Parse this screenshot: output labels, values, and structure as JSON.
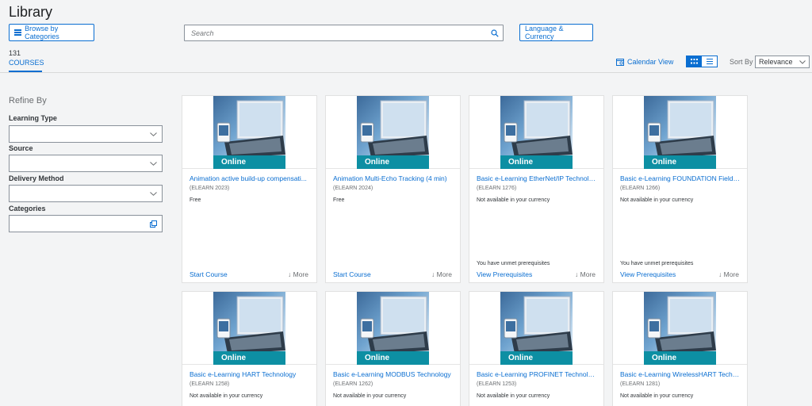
{
  "page": {
    "title": "Library"
  },
  "toolbar": {
    "browse_label": "Browse by Categories",
    "search_placeholder": "Search",
    "language_label": "Language & Currency"
  },
  "results": {
    "count": "131",
    "label": "COURSES"
  },
  "view": {
    "calendar_label": "Calendar View",
    "sort_label": "Sort By",
    "sort_value": "Relevance"
  },
  "refine": {
    "title": "Refine By",
    "filters": [
      {
        "label": "Learning Type"
      },
      {
        "label": "Source"
      },
      {
        "label": "Delivery Method"
      },
      {
        "label": "Categories"
      }
    ]
  },
  "colors": {
    "accent": "#0a6ed1",
    "badge": "#0d8fa3"
  },
  "courses": [
    {
      "badge": "Online",
      "title": "Animation active build-up compensati...",
      "code": "(ELEARN 2023)",
      "price": "Free",
      "note": "",
      "action": "Start Course",
      "more": "↓ More"
    },
    {
      "badge": "Online",
      "title": "Animation Multi-Echo Tracking (4 min)",
      "code": "(ELEARN 2024)",
      "price": "Free",
      "note": "",
      "action": "Start Course",
      "more": "↓ More"
    },
    {
      "badge": "Online",
      "title": "Basic e-Learning EtherNet/IP Technolo...",
      "code": "(ELEARN 1276)",
      "price": "Not available in your currency",
      "note": "You have unmet prerequisites",
      "action": "View Prerequisites",
      "more": "↓ More"
    },
    {
      "badge": "Online",
      "title": "Basic e-Learning FOUNDATION Fieldb...",
      "code": "(ELEARN 1266)",
      "price": "Not available in your currency",
      "note": "You have unmet prerequisites",
      "action": "View Prerequisites",
      "more": "↓ More"
    },
    {
      "badge": "Online",
      "title": "Basic e-Learning HART Technology",
      "code": "(ELEARN 1258)",
      "price": "Not available in your currency",
      "note": "",
      "action": "",
      "more": ""
    },
    {
      "badge": "Online",
      "title": "Basic e-Learning MODBUS Technology",
      "code": "(ELEARN 1262)",
      "price": "Not available in your currency",
      "note": "",
      "action": "",
      "more": ""
    },
    {
      "badge": "Online",
      "title": "Basic e-Learning PROFINET Technology",
      "code": "(ELEARN 1253)",
      "price": "Not available in your currency",
      "note": "",
      "action": "",
      "more": ""
    },
    {
      "badge": "Online",
      "title": "Basic e-Learning WirelessHART Techn...",
      "code": "(ELEARN 1281)",
      "price": "Not available in your currency",
      "note": "",
      "action": "",
      "more": ""
    }
  ]
}
